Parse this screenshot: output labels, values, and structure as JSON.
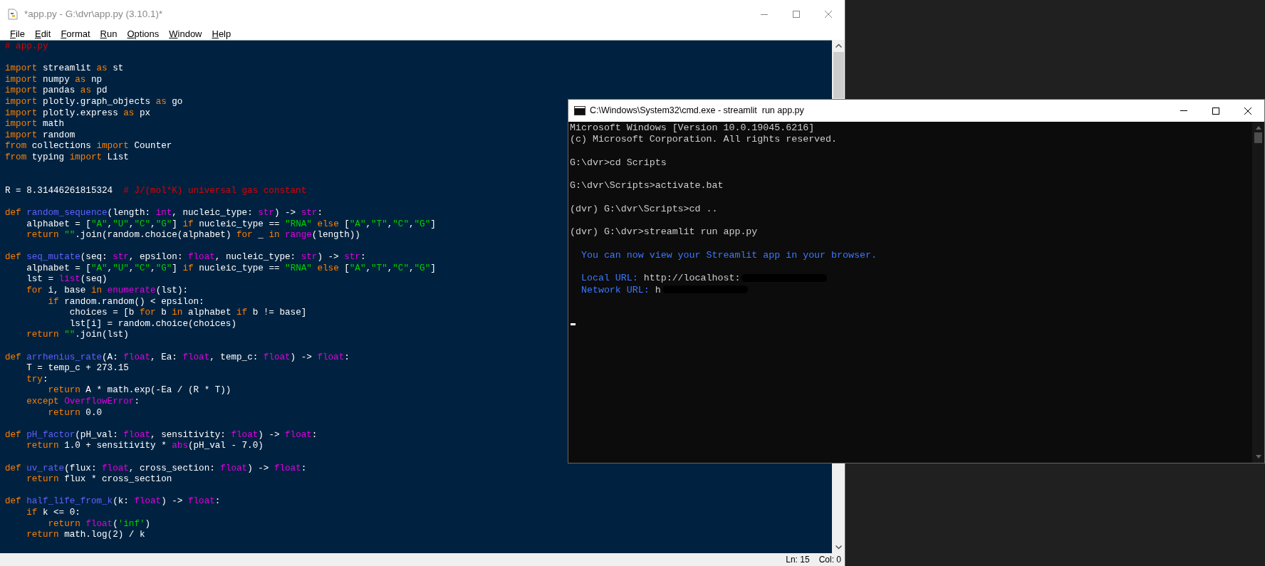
{
  "editor_window": {
    "title": "*app.py - G:\\dvr\\app.py (3.10.1)*",
    "menu": [
      "File",
      "Edit",
      "Format",
      "Run",
      "Options",
      "Window",
      "Help"
    ],
    "code_lines": [
      {
        "kind": "code",
        "segments": [
          {
            "text": "# app.py",
            "kind": "comment"
          }
        ]
      },
      {
        "kind": "blank"
      },
      {
        "kind": "code",
        "segments": [
          {
            "text": "import",
            "kind": "keyword"
          },
          {
            "text": " streamlit ",
            "kind": "plain"
          },
          {
            "text": "as",
            "kind": "keyword"
          },
          {
            "text": " st",
            "kind": "plain"
          }
        ]
      },
      {
        "kind": "code",
        "segments": [
          {
            "text": "import",
            "kind": "keyword"
          },
          {
            "text": " numpy ",
            "kind": "plain"
          },
          {
            "text": "as",
            "kind": "keyword"
          },
          {
            "text": " np",
            "kind": "plain"
          }
        ]
      },
      {
        "kind": "code",
        "segments": [
          {
            "text": "import",
            "kind": "keyword"
          },
          {
            "text": " pandas ",
            "kind": "plain"
          },
          {
            "text": "as",
            "kind": "keyword"
          },
          {
            "text": " pd",
            "kind": "plain"
          }
        ]
      },
      {
        "kind": "code",
        "segments": [
          {
            "text": "import",
            "kind": "keyword"
          },
          {
            "text": " plotly.graph_objects ",
            "kind": "plain"
          },
          {
            "text": "as",
            "kind": "keyword"
          },
          {
            "text": " go",
            "kind": "plain"
          }
        ]
      },
      {
        "kind": "code",
        "segments": [
          {
            "text": "import",
            "kind": "keyword"
          },
          {
            "text": " plotly.express ",
            "kind": "plain"
          },
          {
            "text": "as",
            "kind": "keyword"
          },
          {
            "text": " px",
            "kind": "plain"
          }
        ]
      },
      {
        "kind": "code",
        "segments": [
          {
            "text": "import",
            "kind": "keyword"
          },
          {
            "text": " math",
            "kind": "plain"
          }
        ]
      },
      {
        "kind": "code",
        "segments": [
          {
            "text": "import",
            "kind": "keyword"
          },
          {
            "text": " random",
            "kind": "plain"
          }
        ]
      },
      {
        "kind": "code",
        "segments": [
          {
            "text": "from",
            "kind": "keyword"
          },
          {
            "text": " collections ",
            "kind": "plain"
          },
          {
            "text": "import",
            "kind": "keyword"
          },
          {
            "text": " Counter",
            "kind": "plain"
          }
        ]
      },
      {
        "kind": "code",
        "segments": [
          {
            "text": "from",
            "kind": "keyword"
          },
          {
            "text": " typing ",
            "kind": "plain"
          },
          {
            "text": "import",
            "kind": "keyword"
          },
          {
            "text": " List",
            "kind": "plain"
          }
        ]
      },
      {
        "kind": "blank"
      },
      {
        "kind": "blank"
      },
      {
        "kind": "code",
        "segments": [
          {
            "text": "R = 8.31446261815324  ",
            "kind": "plain"
          },
          {
            "text": "# J/(mol*K) universal gas constant",
            "kind": "comment"
          }
        ]
      },
      {
        "kind": "blank"
      },
      {
        "kind": "code",
        "segments": [
          {
            "text": "def ",
            "kind": "keyword"
          },
          {
            "text": "random_sequence",
            "kind": "function"
          },
          {
            "text": "(length: ",
            "kind": "plain"
          },
          {
            "text": "int",
            "kind": "builtin"
          },
          {
            "text": ", nucleic_type: ",
            "kind": "plain"
          },
          {
            "text": "str",
            "kind": "builtin"
          },
          {
            "text": ") -> ",
            "kind": "plain"
          },
          {
            "text": "str",
            "kind": "builtin"
          },
          {
            "text": ":",
            "kind": "plain"
          }
        ]
      },
      {
        "kind": "code",
        "segments": [
          {
            "text": "    alphabet = [",
            "kind": "plain"
          },
          {
            "text": "\"A\"",
            "kind": "string"
          },
          {
            "text": ",",
            "kind": "plain"
          },
          {
            "text": "\"U\"",
            "kind": "string"
          },
          {
            "text": ",",
            "kind": "plain"
          },
          {
            "text": "\"C\"",
            "kind": "string"
          },
          {
            "text": ",",
            "kind": "plain"
          },
          {
            "text": "\"G\"",
            "kind": "string"
          },
          {
            "text": "] ",
            "kind": "plain"
          },
          {
            "text": "if",
            "kind": "keyword"
          },
          {
            "text": " nucleic_type == ",
            "kind": "plain"
          },
          {
            "text": "\"RNA\" ",
            "kind": "string"
          },
          {
            "text": "else",
            "kind": "keyword"
          },
          {
            "text": " [",
            "kind": "plain"
          },
          {
            "text": "\"A\"",
            "kind": "string"
          },
          {
            "text": ",",
            "kind": "plain"
          },
          {
            "text": "\"T\"",
            "kind": "string"
          },
          {
            "text": ",",
            "kind": "plain"
          },
          {
            "text": "\"C\"",
            "kind": "string"
          },
          {
            "text": ",",
            "kind": "plain"
          },
          {
            "text": "\"G\"",
            "kind": "string"
          },
          {
            "text": "]",
            "kind": "plain"
          }
        ]
      },
      {
        "kind": "code",
        "segments": [
          {
            "text": "    return ",
            "kind": "keyword"
          },
          {
            "text": "\"\"",
            "kind": "string"
          },
          {
            "text": ".join(random.choice(alphabet) ",
            "kind": "plain"
          },
          {
            "text": "for",
            "kind": "keyword"
          },
          {
            "text": " _ ",
            "kind": "plain"
          },
          {
            "text": "in ",
            "kind": "keyword"
          },
          {
            "text": "range",
            "kind": "builtin"
          },
          {
            "text": "(length))",
            "kind": "plain"
          }
        ]
      },
      {
        "kind": "blank"
      },
      {
        "kind": "code",
        "segments": [
          {
            "text": "def ",
            "kind": "keyword"
          },
          {
            "text": "seq_mutate",
            "kind": "function"
          },
          {
            "text": "(seq: ",
            "kind": "plain"
          },
          {
            "text": "str",
            "kind": "builtin"
          },
          {
            "text": ", epsilon: ",
            "kind": "plain"
          },
          {
            "text": "float",
            "kind": "builtin"
          },
          {
            "text": ", nucleic_type: ",
            "kind": "plain"
          },
          {
            "text": "str",
            "kind": "builtin"
          },
          {
            "text": ") -> ",
            "kind": "plain"
          },
          {
            "text": "str",
            "kind": "builtin"
          },
          {
            "text": ":",
            "kind": "plain"
          }
        ]
      },
      {
        "kind": "code",
        "segments": [
          {
            "text": "    alphabet = [",
            "kind": "plain"
          },
          {
            "text": "\"A\"",
            "kind": "string"
          },
          {
            "text": ",",
            "kind": "plain"
          },
          {
            "text": "\"U\"",
            "kind": "string"
          },
          {
            "text": ",",
            "kind": "plain"
          },
          {
            "text": "\"C\"",
            "kind": "string"
          },
          {
            "text": ",",
            "kind": "plain"
          },
          {
            "text": "\"G\"",
            "kind": "string"
          },
          {
            "text": "] ",
            "kind": "plain"
          },
          {
            "text": "if",
            "kind": "keyword"
          },
          {
            "text": " nucleic_type == ",
            "kind": "plain"
          },
          {
            "text": "\"RNA\" ",
            "kind": "string"
          },
          {
            "text": "else",
            "kind": "keyword"
          },
          {
            "text": " [",
            "kind": "plain"
          },
          {
            "text": "\"A\"",
            "kind": "string"
          },
          {
            "text": ",",
            "kind": "plain"
          },
          {
            "text": "\"T\"",
            "kind": "string"
          },
          {
            "text": ",",
            "kind": "plain"
          },
          {
            "text": "\"C\"",
            "kind": "string"
          },
          {
            "text": ",",
            "kind": "plain"
          },
          {
            "text": "\"G\"",
            "kind": "string"
          },
          {
            "text": "]",
            "kind": "plain"
          }
        ]
      },
      {
        "kind": "code",
        "segments": [
          {
            "text": "    lst = ",
            "kind": "plain"
          },
          {
            "text": "list",
            "kind": "builtin"
          },
          {
            "text": "(seq)",
            "kind": "plain"
          }
        ]
      },
      {
        "kind": "code",
        "segments": [
          {
            "text": "    for",
            "kind": "keyword"
          },
          {
            "text": " i, base ",
            "kind": "plain"
          },
          {
            "text": "in ",
            "kind": "keyword"
          },
          {
            "text": "enumerate",
            "kind": "builtin"
          },
          {
            "text": "(lst):",
            "kind": "plain"
          }
        ]
      },
      {
        "kind": "code",
        "segments": [
          {
            "text": "        if",
            "kind": "keyword"
          },
          {
            "text": " random.random() < epsilon:",
            "kind": "plain"
          }
        ]
      },
      {
        "kind": "code",
        "segments": [
          {
            "text": "            choices = [b ",
            "kind": "plain"
          },
          {
            "text": "for",
            "kind": "keyword"
          },
          {
            "text": " b ",
            "kind": "plain"
          },
          {
            "text": "in",
            "kind": "keyword"
          },
          {
            "text": " alphabet ",
            "kind": "plain"
          },
          {
            "text": "if",
            "kind": "keyword"
          },
          {
            "text": " b != base]",
            "kind": "plain"
          }
        ]
      },
      {
        "kind": "code",
        "segments": [
          {
            "text": "            lst[i] = random.choice(choices)",
            "kind": "plain"
          }
        ]
      },
      {
        "kind": "code",
        "segments": [
          {
            "text": "    return ",
            "kind": "keyword"
          },
          {
            "text": "\"\"",
            "kind": "string"
          },
          {
            "text": ".join(lst)",
            "kind": "plain"
          }
        ]
      },
      {
        "kind": "blank"
      },
      {
        "kind": "code",
        "segments": [
          {
            "text": "def ",
            "kind": "keyword"
          },
          {
            "text": "arrhenius_rate",
            "kind": "function"
          },
          {
            "text": "(A: ",
            "kind": "plain"
          },
          {
            "text": "float",
            "kind": "builtin"
          },
          {
            "text": ", Ea: ",
            "kind": "plain"
          },
          {
            "text": "float",
            "kind": "builtin"
          },
          {
            "text": ", temp_c: ",
            "kind": "plain"
          },
          {
            "text": "float",
            "kind": "builtin"
          },
          {
            "text": ") -> ",
            "kind": "plain"
          },
          {
            "text": "float",
            "kind": "builtin"
          },
          {
            "text": ":",
            "kind": "plain"
          }
        ]
      },
      {
        "kind": "code",
        "segments": [
          {
            "text": "    T = temp_c + 273.15",
            "kind": "plain"
          }
        ]
      },
      {
        "kind": "code",
        "segments": [
          {
            "text": "    try",
            "kind": "keyword"
          },
          {
            "text": ":",
            "kind": "plain"
          }
        ]
      },
      {
        "kind": "code",
        "segments": [
          {
            "text": "        return",
            "kind": "keyword"
          },
          {
            "text": " A * math.exp(-Ea / (R * T))",
            "kind": "plain"
          }
        ]
      },
      {
        "kind": "code",
        "segments": [
          {
            "text": "    except ",
            "kind": "keyword"
          },
          {
            "text": "OverflowError",
            "kind": "builtin"
          },
          {
            "text": ":",
            "kind": "plain"
          }
        ]
      },
      {
        "kind": "code",
        "segments": [
          {
            "text": "        return",
            "kind": "keyword"
          },
          {
            "text": " 0.0",
            "kind": "plain"
          }
        ]
      },
      {
        "kind": "blank"
      },
      {
        "kind": "code",
        "segments": [
          {
            "text": "def ",
            "kind": "keyword"
          },
          {
            "text": "pH_factor",
            "kind": "function"
          },
          {
            "text": "(pH_val: ",
            "kind": "plain"
          },
          {
            "text": "float",
            "kind": "builtin"
          },
          {
            "text": ", sensitivity: ",
            "kind": "plain"
          },
          {
            "text": "float",
            "kind": "builtin"
          },
          {
            "text": ") -> ",
            "kind": "plain"
          },
          {
            "text": "float",
            "kind": "builtin"
          },
          {
            "text": ":",
            "kind": "plain"
          }
        ]
      },
      {
        "kind": "code",
        "segments": [
          {
            "text": "    return",
            "kind": "keyword"
          },
          {
            "text": " 1.0 + sensitivity * ",
            "kind": "plain"
          },
          {
            "text": "abs",
            "kind": "builtin"
          },
          {
            "text": "(pH_val - 7.0)",
            "kind": "plain"
          }
        ]
      },
      {
        "kind": "blank"
      },
      {
        "kind": "code",
        "segments": [
          {
            "text": "def ",
            "kind": "keyword"
          },
          {
            "text": "uv_rate",
            "kind": "function"
          },
          {
            "text": "(flux: ",
            "kind": "plain"
          },
          {
            "text": "float",
            "kind": "builtin"
          },
          {
            "text": ", cross_section: ",
            "kind": "plain"
          },
          {
            "text": "float",
            "kind": "builtin"
          },
          {
            "text": ") -> ",
            "kind": "plain"
          },
          {
            "text": "float",
            "kind": "builtin"
          },
          {
            "text": ":",
            "kind": "plain"
          }
        ]
      },
      {
        "kind": "code",
        "segments": [
          {
            "text": "    return",
            "kind": "keyword"
          },
          {
            "text": " flux * cross_section",
            "kind": "plain"
          }
        ]
      },
      {
        "kind": "blank"
      },
      {
        "kind": "code",
        "segments": [
          {
            "text": "def ",
            "kind": "keyword"
          },
          {
            "text": "half_life_from_k",
            "kind": "function"
          },
          {
            "text": "(k: ",
            "kind": "plain"
          },
          {
            "text": "float",
            "kind": "builtin"
          },
          {
            "text": ") -> ",
            "kind": "plain"
          },
          {
            "text": "float",
            "kind": "builtin"
          },
          {
            "text": ":",
            "kind": "plain"
          }
        ]
      },
      {
        "kind": "code",
        "segments": [
          {
            "text": "    if",
            "kind": "keyword"
          },
          {
            "text": " k <= 0:",
            "kind": "plain"
          }
        ]
      },
      {
        "kind": "code",
        "segments": [
          {
            "text": "        return ",
            "kind": "keyword"
          },
          {
            "text": "float",
            "kind": "builtin"
          },
          {
            "text": "(",
            "kind": "plain"
          },
          {
            "text": "'inf'",
            "kind": "string"
          },
          {
            "text": ")",
            "kind": "plain"
          }
        ]
      },
      {
        "kind": "code",
        "segments": [
          {
            "text": "    return",
            "kind": "keyword"
          },
          {
            "text": " math.log(2) / k",
            "kind": "plain"
          }
        ]
      }
    ],
    "status_bar": {
      "line": "Ln: 15",
      "column": "Col: 0"
    }
  },
  "terminal_window": {
    "title": "C:\\Windows\\System32\\cmd.exe - streamlit  run app.py",
    "lines": [
      {
        "kind": "text",
        "segments": [
          {
            "text": "Microsoft Windows [Version 10.0.19045.6216]",
            "kind": "plain"
          }
        ]
      },
      {
        "kind": "text",
        "segments": [
          {
            "text": "(c) Microsoft Corporation. All rights reserved.",
            "kind": "plain"
          }
        ]
      },
      {
        "kind": "blank"
      },
      {
        "kind": "text",
        "segments": [
          {
            "text": "G:\\dvr>cd Scripts",
            "kind": "plain"
          }
        ]
      },
      {
        "kind": "blank"
      },
      {
        "kind": "text",
        "segments": [
          {
            "text": "G:\\dvr\\Scripts>activate.bat",
            "kind": "plain"
          }
        ]
      },
      {
        "kind": "blank"
      },
      {
        "kind": "text",
        "segments": [
          {
            "text": "(dvr) G:\\dvr\\Scripts>cd ..",
            "kind": "plain"
          }
        ]
      },
      {
        "kind": "blank"
      },
      {
        "kind": "text",
        "segments": [
          {
            "text": "(dvr) G:\\dvr>streamlit run app.py",
            "kind": "plain"
          }
        ]
      },
      {
        "kind": "blank"
      },
      {
        "kind": "text",
        "segments": [
          {
            "text": "  You can now view your Streamlit app in your browser.",
            "kind": "info"
          }
        ]
      },
      {
        "kind": "blank"
      },
      {
        "kind": "redacted",
        "segments": [
          {
            "text": "  Local URL: ",
            "kind": "info"
          },
          {
            "text": "http://localhost:",
            "kind": "plain"
          }
        ]
      },
      {
        "kind": "redacted",
        "segments": [
          {
            "text": "  Network URL: ",
            "kind": "info"
          },
          {
            "text": "h",
            "kind": "plain"
          }
        ]
      },
      {
        "kind": "blank"
      },
      {
        "kind": "blank"
      },
      {
        "kind": "cursor"
      }
    ]
  }
}
